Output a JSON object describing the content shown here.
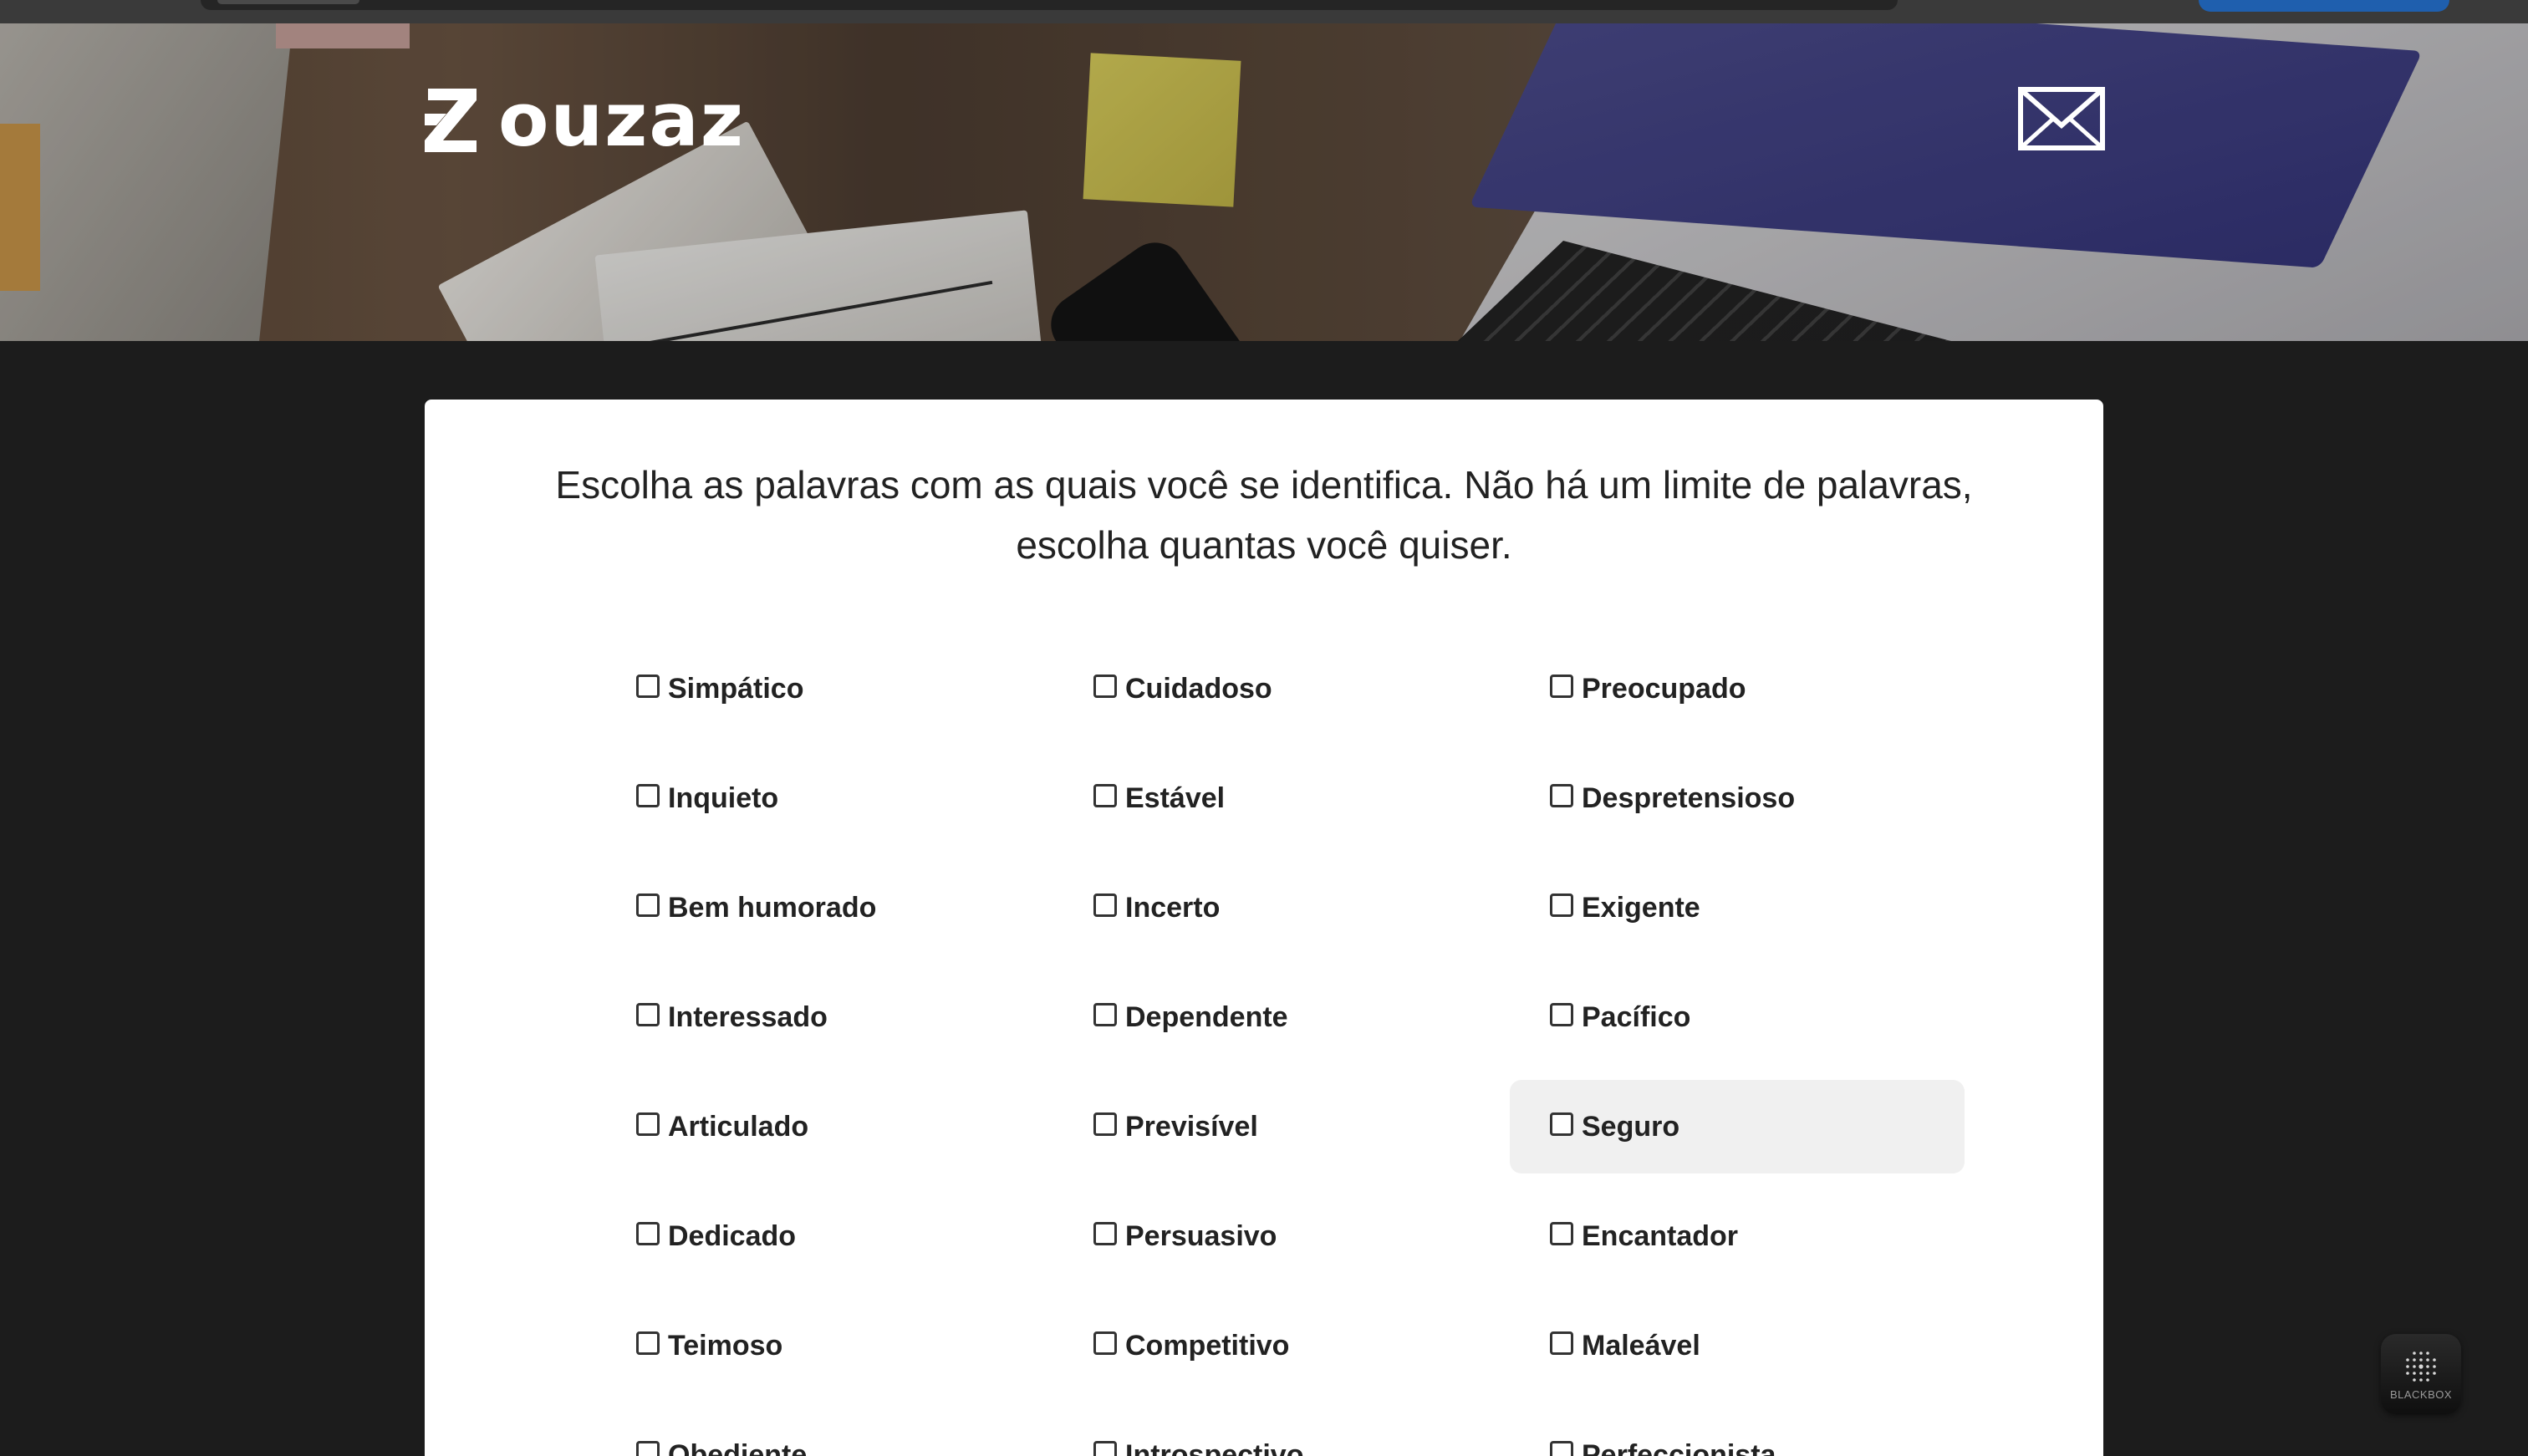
{
  "brand": {
    "name": "ouzaz"
  },
  "intro": "Escolha as palavras com as quais você se identifica. Não há um limite de palavras, escolha quantas você quiser.",
  "options": [
    [
      "Simpático",
      "Cuidadoso",
      "Preocupado"
    ],
    [
      "Inquieto",
      "Estável",
      "Despretensioso"
    ],
    [
      "Bem humorado",
      "Incerto",
      "Exigente"
    ],
    [
      "Interessado",
      "Dependente",
      "Pacífico"
    ],
    [
      "Articulado",
      "Previsível",
      "Seguro"
    ],
    [
      "Dedicado",
      "Persuasivo",
      "Encantador"
    ],
    [
      "Teimoso",
      "Competitivo",
      "Maleável"
    ],
    [
      "Obediente",
      "Introspectivo",
      "Perfeccionista"
    ]
  ],
  "checked": [],
  "hovered_option": "Seguro",
  "icons": {
    "mail": "mail-icon",
    "logo": "logo-mark-icon",
    "widget": "blackbox-icon"
  },
  "widget": {
    "label": "BLACKBOX"
  },
  "colors": {
    "page_bg": "#1c1c1c",
    "card_bg": "#ffffff",
    "text": "#222222",
    "hover_bg": "#f0f0f0"
  }
}
